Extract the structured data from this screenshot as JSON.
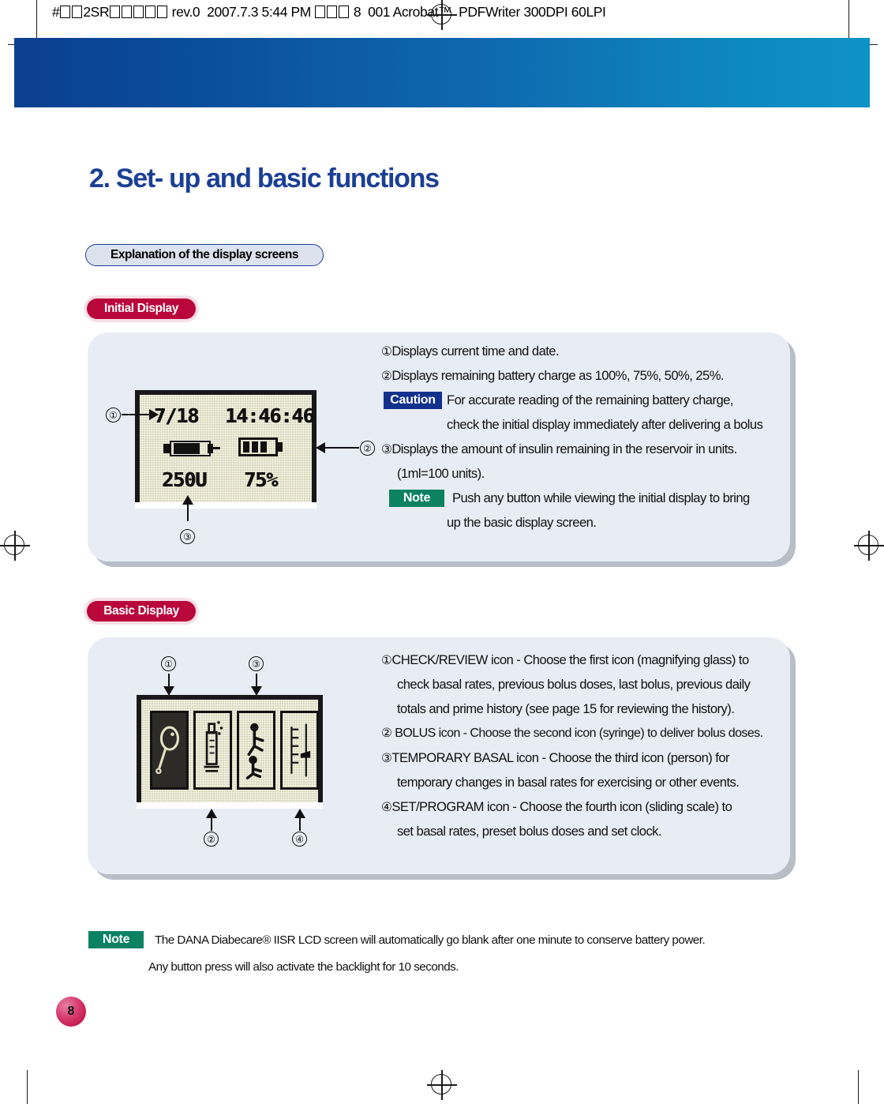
{
  "print_header": {
    "prefix": "#",
    "text_parts": [
      "2SR",
      "rev.0  2007.7.3 5:44 PM",
      "8   001 Acrobat",
      "PDFWriter 300DPI 60LPI"
    ],
    "full_text": "#□□2SR□□□□□ rev.0  2007.7.3 5:44 PM □□□ 8   001 Acrobat™  PDFWriter 300DPI 60LPI"
  },
  "chapter": {
    "title": "2. Set- up and basic functions",
    "title_color": "#1b3f94"
  },
  "section": {
    "header": "Explanation of the display screens"
  },
  "initial_display": {
    "pill_label": "Initial Display",
    "lcd": {
      "date": "7/18",
      "time": "14:46:46",
      "units": "250U",
      "battery": "75%",
      "syringe_icon": "syringe-icon",
      "battery_icon": "battery-icon"
    },
    "callouts": [
      "①",
      "②",
      "③"
    ],
    "lines": [
      {
        "marker": "①",
        "text": "Displays current time and date."
      },
      {
        "marker": "②",
        "text": "Displays remaining battery charge as 100%, 75%, 50%, 25%."
      },
      {
        "badge": "Caution",
        "badge_color": "#12308c",
        "text": "For accurate reading of the remaining battery charge,"
      },
      {
        "text": "check the initial display immediately after delivering a bolus"
      },
      {
        "marker": "③",
        "text": "Displays the amount of insulin remaining in the reservoir in units."
      },
      {
        "text": "(1ml=100 units)."
      },
      {
        "badge": "Note",
        "badge_color": "#0c8263",
        "text": "Push any button while viewing the initial display to bring"
      },
      {
        "text": "up the basic display screen."
      }
    ]
  },
  "basic_display": {
    "pill_label": "Basic Display",
    "callouts": [
      "①",
      "②",
      "③",
      "④"
    ],
    "icons": [
      "magnifying-glass-icon",
      "syringe-icon",
      "person-exercising-icon",
      "sliding-scale-icon"
    ],
    "lines": [
      {
        "marker": "①",
        "text": "CHECK/REVIEW icon -   Choose the first icon (magnifying glass) to"
      },
      {
        "text": "check basal rates, previous bolus doses, last bolus, previous daily"
      },
      {
        "text": "totals and prime history (see page 15 for reviewing the history)."
      },
      {
        "marker": "②",
        "text": " BOLUS icon -   Choose the second icon (syringe) to deliver bolus doses."
      },
      {
        "marker": "③",
        "text": "TEMPORARY BASAL icon -   Choose the third icon (person) for"
      },
      {
        "text": "temporary changes in basal rates for exercising or other events."
      },
      {
        "marker": "④",
        "text": "SET/PROGRAM icon -   Choose the fourth icon (sliding scale) to"
      },
      {
        "text": "set basal rates, preset bolus doses and set clock."
      }
    ]
  },
  "footer_note": {
    "badge": "Note",
    "line1": "The DANA Diabecare® IISR LCD screen will automatically go blank after one minute to conserve battery power.",
    "line2": "Any button press will also activate the backlight for 10 seconds."
  },
  "page_number": "8"
}
